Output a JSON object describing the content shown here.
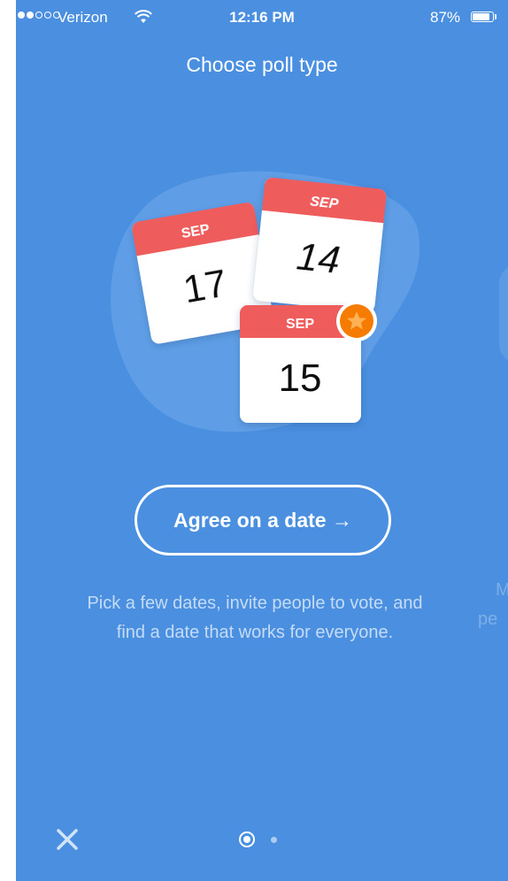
{
  "status_bar": {
    "carrier": "Verizon",
    "time": "12:16 PM",
    "battery": "87%",
    "battery_level": 0.87,
    "signal_bars_filled": 2,
    "signal_bars_total": 5
  },
  "header": {
    "title": "Choose poll type"
  },
  "illustration": {
    "calendars": [
      {
        "month": "SEP",
        "day": "17"
      },
      {
        "month": "SEP",
        "day": "14"
      },
      {
        "month": "SEP",
        "day": "15",
        "starred": true
      }
    ]
  },
  "poll_type": {
    "button_label": "Agree on a date →",
    "description": "Pick a few dates, invite people to vote, and find a date that works for everyone."
  },
  "next_card_peek": {
    "line1": "M",
    "line2": "pe"
  },
  "pager": {
    "pages": 2,
    "current": 1
  },
  "colors": {
    "background": "#4a8fe0",
    "calendar_header": "#ef5b5b",
    "star_badge": "#f57c00",
    "blob": "#5f9ee6"
  },
  "icons": {
    "close": "close-icon",
    "wifi": "wifi-icon",
    "star": "star-icon"
  }
}
